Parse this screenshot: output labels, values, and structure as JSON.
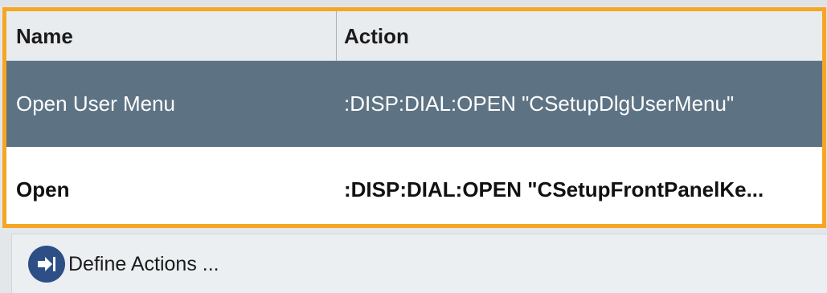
{
  "table": {
    "columns": [
      {
        "label": "Name"
      },
      {
        "label": "Action"
      }
    ],
    "rows": [
      {
        "name": "Open User Menu",
        "action": ":DISP:DIAL:OPEN \"CSetupDlgUserMenu\"",
        "selected": true
      },
      {
        "name": "Open",
        "action": ":DISP:DIAL:OPEN \"CSetupFrontPanelKe...",
        "selected": false
      }
    ]
  },
  "actions": {
    "define_label": "Define Actions ...",
    "define_icon": "arrow-right-icon"
  },
  "colors": {
    "focus_border": "#f5a623",
    "selected_row": "#5d7384",
    "icon_circle": "#2d4f86"
  }
}
